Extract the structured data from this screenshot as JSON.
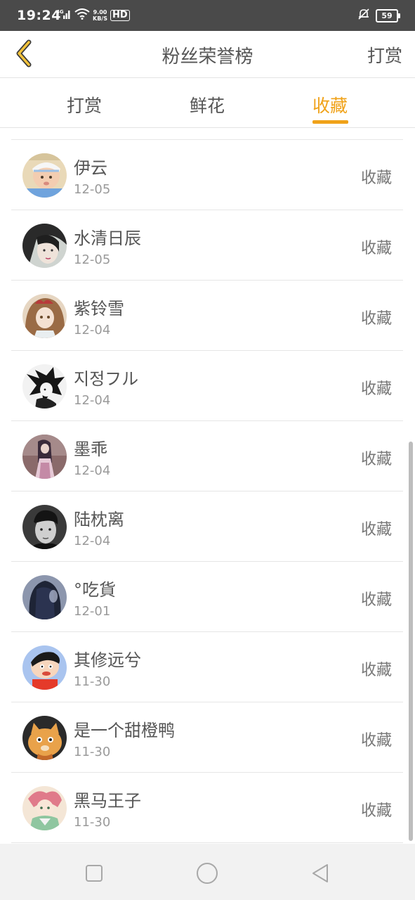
{
  "status_bar": {
    "time": "19:24",
    "network": "4G",
    "speed_value": "9.00",
    "speed_unit": "KB/S",
    "hd": "HD",
    "battery": "59"
  },
  "header": {
    "title": "粉丝荣誉榜",
    "action_label": "打赏",
    "back_icon": "chevron-left-icon",
    "accent_color": "#f0a219"
  },
  "tabs": [
    {
      "label": "打赏",
      "active": false
    },
    {
      "label": "鲜花",
      "active": false
    },
    {
      "label": "收藏",
      "active": true
    }
  ],
  "fans": [
    {
      "name": "伊云",
      "date": "12-05",
      "action": "收藏"
    },
    {
      "name": "水清日辰",
      "date": "12-05",
      "action": "收藏"
    },
    {
      "name": "紫铃雪",
      "date": "12-04",
      "action": "收藏"
    },
    {
      "name": "지정フル",
      "date": "12-04",
      "action": "收藏"
    },
    {
      "name": "墨乖",
      "date": "12-04",
      "action": "收藏"
    },
    {
      "name": "陆枕离",
      "date": "12-04",
      "action": "收藏"
    },
    {
      "name": "°吃貨",
      "date": "12-01",
      "action": "收藏"
    },
    {
      "name": "其修远兮",
      "date": "11-30",
      "action": "收藏"
    },
    {
      "name": "是一个甜橙鸭",
      "date": "11-30",
      "action": "收藏"
    },
    {
      "name": "黑马王子",
      "date": "11-30",
      "action": "收藏"
    }
  ],
  "nav_bar": {
    "recents_icon": "square-icon",
    "home_icon": "circle-icon",
    "back_icon": "triangle-back-icon"
  }
}
